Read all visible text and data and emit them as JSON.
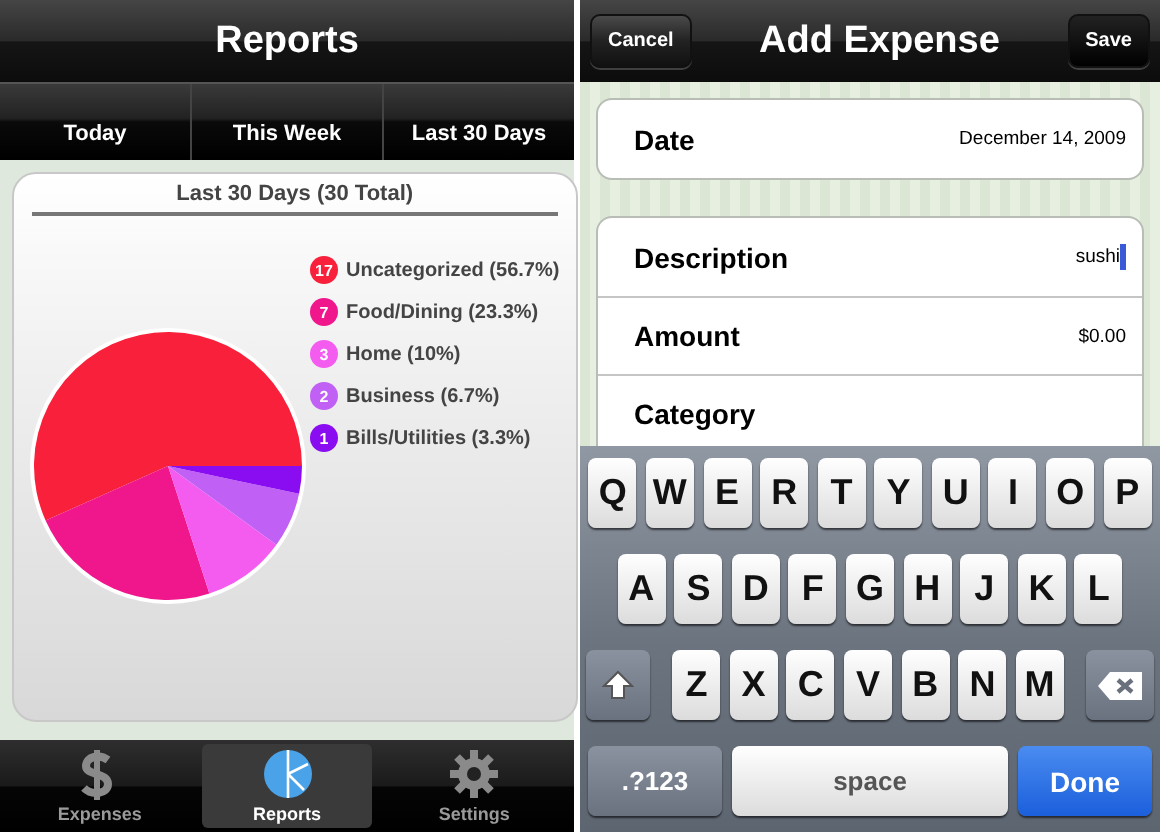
{
  "reports": {
    "title": "Reports",
    "segments": [
      {
        "label": "Today"
      },
      {
        "label": "This Week"
      },
      {
        "label": "Last 30 Days"
      }
    ],
    "chart_data": {
      "type": "pie",
      "title": "Last 30 Days (30 Total)",
      "categories": [
        "Uncategorized (56.7%)",
        "Food/Dining (23.3%)",
        "Home (10%)",
        "Business (6.7%)",
        "Bills/Utilities (3.3%)"
      ],
      "values": [
        17,
        7,
        3,
        2,
        1
      ],
      "data_labels": true,
      "legend": true
    },
    "legend": [
      {
        "color": "#f8203a"
      },
      {
        "color": "#f0168c"
      },
      {
        "color": "#f45cf0"
      },
      {
        "color": "#c060f4"
      },
      {
        "color": "#8a0cf0"
      }
    ],
    "tab_bar": [
      {
        "label": "Expenses",
        "kind": "dollar",
        "selected": false
      },
      {
        "label": "Reports",
        "kind": "pie",
        "selected": true
      },
      {
        "label": "Settings",
        "kind": "gear",
        "selected": false
      }
    ]
  },
  "add_expense": {
    "title": "Add Expense",
    "cancel": "Cancel",
    "save": "Save",
    "date": {
      "label": "Date",
      "value": "December 14, 2009"
    },
    "fields": [
      {
        "label": "Description",
        "value": "sushi",
        "focused": true
      },
      {
        "label": "Amount",
        "value": "$0.00",
        "focused": false
      },
      {
        "label": "Category",
        "focused": false
      }
    ],
    "keyboard": {
      "rows": [
        {
          "keys": [
            "Q",
            "W",
            "E",
            "R",
            "T",
            "Y",
            "U",
            "I",
            "O",
            "P"
          ]
        },
        {
          "keys": [
            "A",
            "S",
            "D",
            "F",
            "G",
            "H",
            "J",
            "K",
            "L"
          ]
        },
        {
          "keys": [
            "Z",
            "X",
            "C",
            "V",
            "B",
            "N",
            "M"
          ]
        }
      ],
      "bottom": [
        {
          "label": ".?123",
          "kind": "mode"
        },
        {
          "label": "space",
          "kind": "space"
        },
        {
          "label": "Done",
          "kind": "done"
        }
      ]
    }
  }
}
